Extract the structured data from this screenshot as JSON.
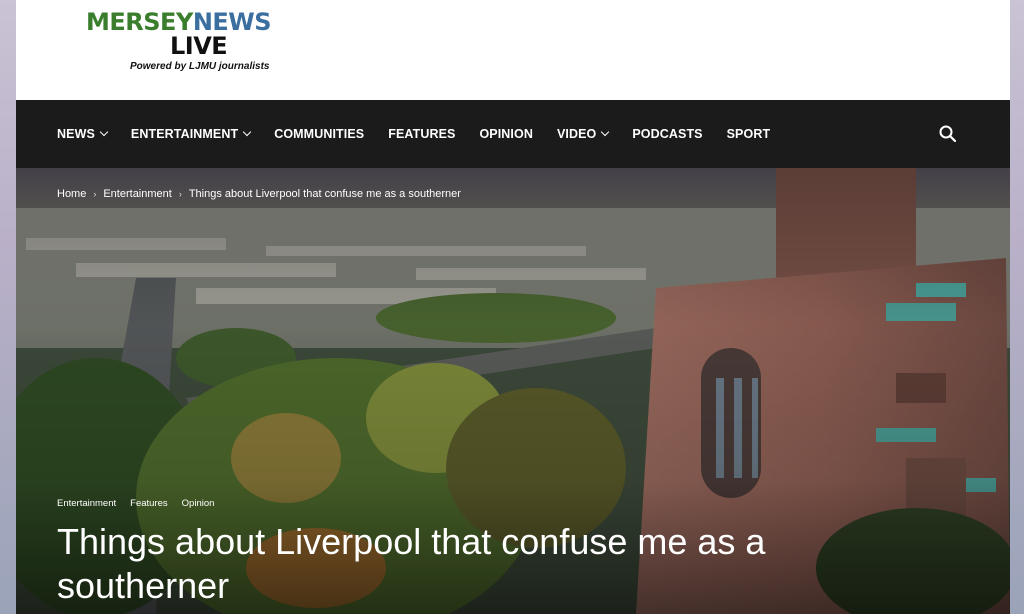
{
  "logo": {
    "word1": "MERSEY",
    "word2": "NEWS",
    "word3": "LIVE",
    "tagline": "Powered by LJMU journalists"
  },
  "nav": {
    "items": [
      {
        "label": "NEWS",
        "dropdown": true
      },
      {
        "label": "ENTERTAINMENT",
        "dropdown": true
      },
      {
        "label": "COMMUNITIES",
        "dropdown": false
      },
      {
        "label": "FEATURES",
        "dropdown": false
      },
      {
        "label": "OPINION",
        "dropdown": false
      },
      {
        "label": "VIDEO",
        "dropdown": true
      },
      {
        "label": "PODCASTS",
        "dropdown": false
      },
      {
        "label": "SPORT",
        "dropdown": false
      }
    ],
    "search_icon": "search-icon"
  },
  "breadcrumb": {
    "items": [
      "Home",
      "Entertainment",
      "Things about Liverpool that confuse me as a southerner"
    ],
    "separator": "›"
  },
  "article": {
    "tags": [
      "Entertainment",
      "Features",
      "Opinion"
    ],
    "title": "Things about Liverpool that confuse me as a southerner"
  },
  "colors": {
    "logo_green": "#3a7d2c",
    "logo_blue": "#3b6fa0",
    "nav_bg": "#1b1b1b"
  }
}
